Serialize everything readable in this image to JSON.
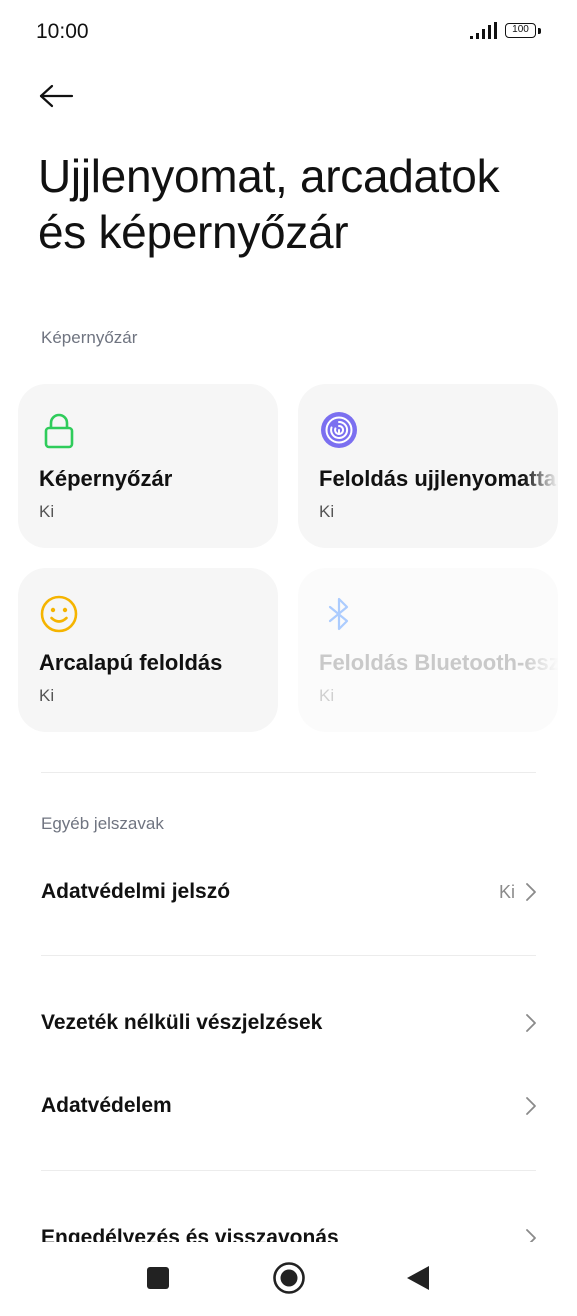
{
  "status_bar": {
    "time": "10:00",
    "battery": "100"
  },
  "header": {
    "back_icon": "arrow-left-icon",
    "title": "Ujjlenyomat, arcadatok és képernyőzár"
  },
  "screen_lock_section": {
    "label": "Képernyőzár",
    "cards": [
      {
        "title": "Képernyőzár",
        "status": "Ki",
        "icon": "lock-icon",
        "icon_color": "#2fcc5b",
        "enabled": true
      },
      {
        "title": "Feloldás ujjlenyomattal",
        "status": "Ki",
        "icon": "fingerprint-icon",
        "icon_color": "#7b6ff0",
        "enabled": true
      },
      {
        "title": "Arcalapú feloldás",
        "status": "Ki",
        "icon": "face-icon",
        "icon_color": "#f5b400",
        "enabled": true
      },
      {
        "title": "Feloldás Bluetooth-eszközzel",
        "status": "Ki",
        "icon": "bluetooth-icon",
        "icon_color": "#8ab8ff",
        "enabled": false
      }
    ]
  },
  "other_passwords_section": {
    "label": "Egyéb jelszavak",
    "items": [
      {
        "label": "Adatvédelmi jelszó",
        "value": "Ki"
      }
    ]
  },
  "more_items": [
    {
      "label": "Vezeték nélküli vészjelzések"
    },
    {
      "label": "Adatvédelem"
    }
  ],
  "partial_item": {
    "label": "Engedélyezés és visszavonás"
  },
  "nav_bar": {
    "recents_icon": "square-icon",
    "home_icon": "circle-icon",
    "back_icon": "triangle-back-icon"
  }
}
